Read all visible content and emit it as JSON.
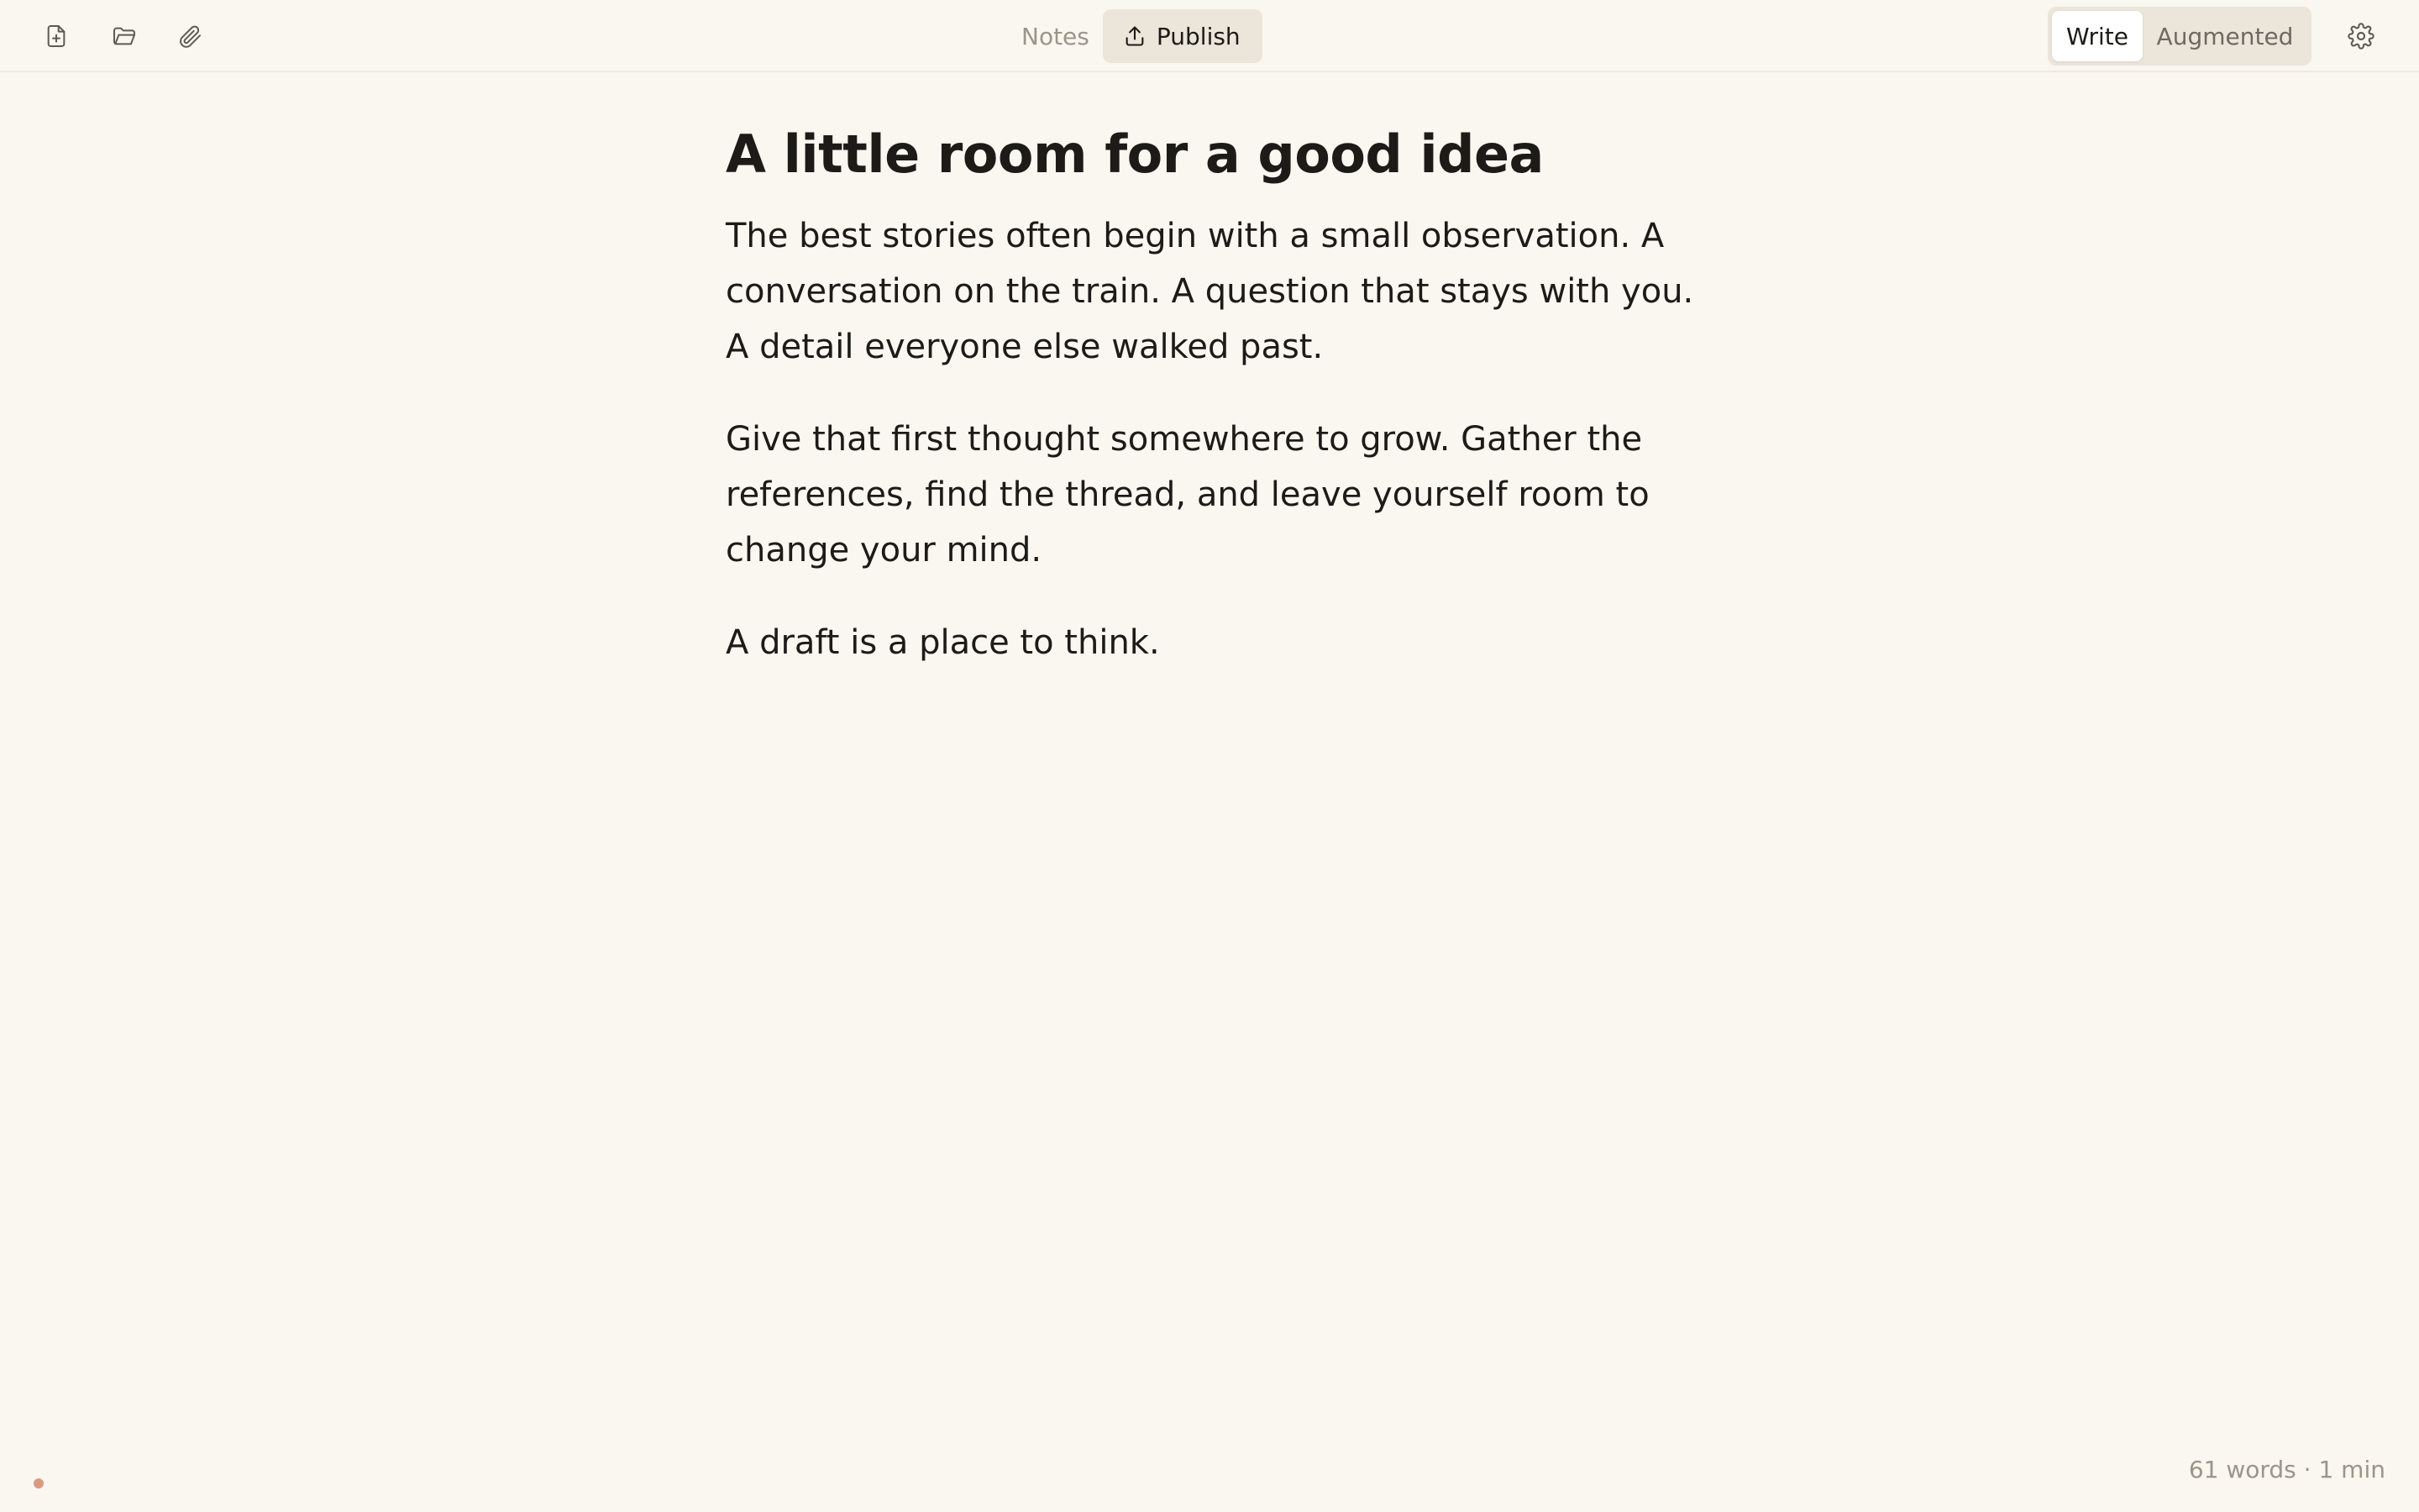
{
  "toolbar": {
    "left_icons": [
      "new-document-icon",
      "open-folder-icon",
      "paperclip-icon"
    ],
    "notes_label": "Notes",
    "publish_label": "Publish",
    "mode": {
      "options": [
        "Write",
        "Augmented"
      ],
      "selected": "Write"
    },
    "settings_icon": "gear-icon"
  },
  "document": {
    "title": "A little room for a good idea",
    "paragraphs": [
      "The best stories often begin with a small observation. A conversation on the train. A question that stays with you. A detail everyone else walked past.",
      "Give that first thought somewhere to grow. Gather the references, find the thread, and leave yourself room to change your mind.",
      "A draft is a place to think."
    ]
  },
  "status": {
    "stats": "61 words · 1 min"
  },
  "colors": {
    "background": "#faf6f0",
    "text": "#1c1b18",
    "muted": "#9b958a",
    "button_bg": "#ebe5da",
    "status_dot": "#d99a82"
  }
}
